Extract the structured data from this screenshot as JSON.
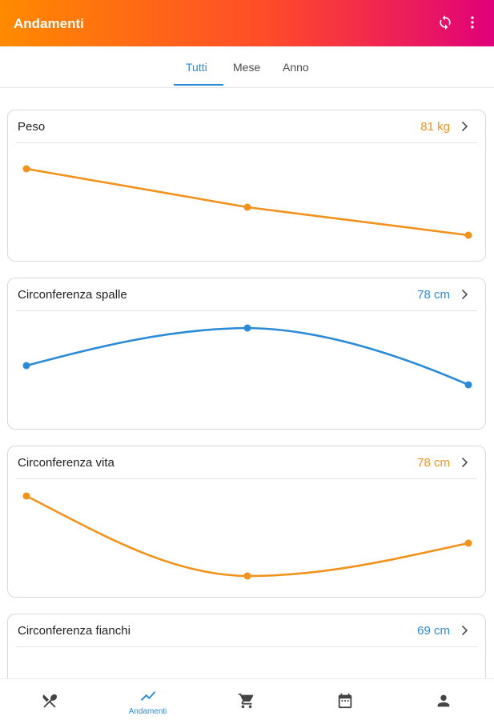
{
  "app": {
    "title": "Andamenti"
  },
  "header_actions": {
    "icons": [
      "sync-icon",
      "more-vert-icon"
    ]
  },
  "tabs": [
    {
      "label": "Tutti",
      "active": true
    },
    {
      "label": "Mese",
      "active": false
    },
    {
      "label": "Anno",
      "active": false
    }
  ],
  "cards": [
    {
      "title": "Peso",
      "value": "81 kg",
      "color": "#f0921c"
    },
    {
      "title": "Circonferenza spalle",
      "value": "78 cm",
      "color": "#2b8ad8"
    },
    {
      "title": "Circonferenza vita",
      "value": "78 cm",
      "color": "#f0921c"
    },
    {
      "title": "Circonferenza fianchi",
      "value": "69 cm",
      "color": "#2b8ad8"
    }
  ],
  "bottom_nav": {
    "items": [
      {
        "icon": "utensils-icon",
        "label": ""
      },
      {
        "icon": "trend-icon",
        "label": "Andamenti",
        "active": true
      },
      {
        "icon": "cart-icon",
        "label": ""
      },
      {
        "icon": "calendar-icon",
        "label": ""
      },
      {
        "icon": "person-icon",
        "label": ""
      }
    ]
  },
  "colors": {
    "accent_blue": "#2b8ad8",
    "accent_orange": "#f0921c",
    "gradient_start": "#ff8a00",
    "gradient_end": "#e0007a"
  }
}
